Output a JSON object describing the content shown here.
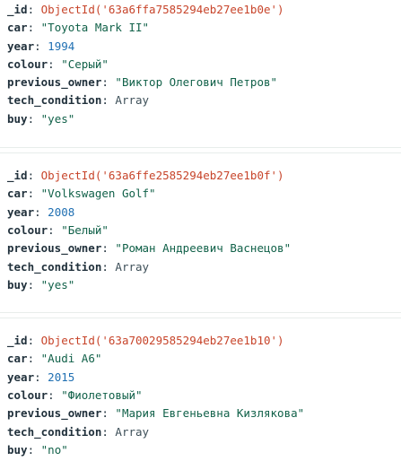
{
  "documents": [
    {
      "_id": "ObjectId('63a6ffa7585294eb27ee1b0e')",
      "car": "\"Toyota Mark II\"",
      "year": "1994",
      "colour": "\"Серый\"",
      "previous_owner": "\"Виктор Олегович Петров\"",
      "tech_condition": "Array",
      "buy": "\"yes\""
    },
    {
      "_id": "ObjectId('63a6ffe2585294eb27ee1b0f')",
      "car": "\"Volkswagen Golf\"",
      "year": "2008",
      "colour": "\"Белый\"",
      "previous_owner": "\"Роман Андреевич Васнецов\"",
      "tech_condition": "Array",
      "buy": "\"yes\""
    },
    {
      "_id": "ObjectId('63a70029585294eb27ee1b10')",
      "car": "\"Audi A6\"",
      "year": "2015",
      "colour": "\"Фиолетовый\"",
      "previous_owner": "\"Мария Евгеньевна Кизлякова\"",
      "tech_condition": "Array",
      "buy": "\"no\""
    }
  ],
  "keys": {
    "id": "_id",
    "car": "car",
    "year": "year",
    "colour": "colour",
    "previous_owner": "previous_owner",
    "tech_condition": "tech_condition",
    "buy": "buy"
  },
  "colors": {
    "key": "#21313c",
    "objectid": "#c7442a",
    "string": "#116149",
    "number": "#1f6fb2",
    "type": "#3d4f58",
    "separator": "#e8edeb"
  }
}
